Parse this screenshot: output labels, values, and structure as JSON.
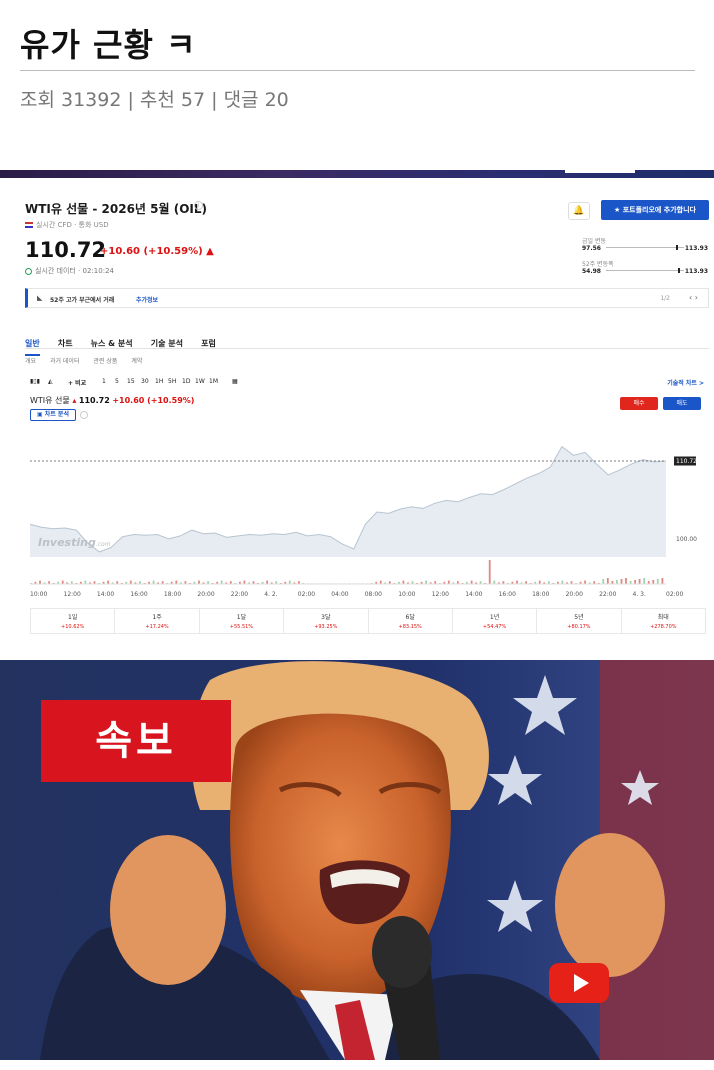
{
  "post": {
    "title": "유가 근황 ㅋ",
    "stats": "조회 31392 | 추천 57 | 댓글 20"
  },
  "screenshot": {
    "instrument_title": "WTI유 선물 - 2026년 5월 (OIL)",
    "subtitle": "실시간 CFD · 통화 USD",
    "price": "110.72",
    "change": "+10.60 (+10.59%) ▲",
    "time_label": "실시간 데이터 · 02:10:24",
    "portfolio_button": "포트폴리오에 추가합니다",
    "day_range": {
      "label": "금일 변동",
      "low": "97.56",
      "high": "113.93",
      "level": 0.92
    },
    "week52_range": {
      "label": "52주 변동폭",
      "low": "54.98",
      "high": "113.93",
      "level": 0.95
    },
    "alert": {
      "text": "52주 고가 부근에서 거래",
      "more": "추가정보",
      "page": "1/2",
      "arrows": "‹  ›"
    },
    "tabs": [
      "일반",
      "차트",
      "뉴스 & 분석",
      "기술 분석",
      "포럼"
    ],
    "subtabs": [
      "개요",
      "과거 데이터",
      "관련 상품",
      "계약"
    ],
    "toolbar": {
      "compare": "+ 비교",
      "intervals": [
        "1",
        "5",
        "15",
        "30",
        "1H",
        "5H",
        "1D",
        "1W",
        "1M"
      ],
      "technical_chart": "기술적 차트 >"
    },
    "mini": {
      "name": "WTI유 선물",
      "price": "110.72",
      "change": "+10.60 (+10.59%)",
      "chart_analysis": "차트 분석",
      "buy": "매수",
      "sell": "매도"
    },
    "watermark": "Investing",
    "watermark_suffix": ".com",
    "performance": [
      {
        "period": "1일",
        "value": "+10.62%"
      },
      {
        "period": "1주",
        "value": "+17.24%"
      },
      {
        "period": "1달",
        "value": "+55.51%"
      },
      {
        "period": "3달",
        "value": "+93.25%"
      },
      {
        "period": "6달",
        "value": "+83.15%"
      },
      {
        "period": "1년",
        "value": "+54.47%"
      },
      {
        "period": "5년",
        "value": "+80.17%"
      },
      {
        "period": "최대",
        "value": "+278.70%"
      }
    ]
  },
  "chart_data": {
    "type": "area",
    "title": "",
    "xlabel": "",
    "ylabel": "",
    "x": [
      "10:00",
      "12:00",
      "14:00",
      "16:00",
      "18:00",
      "20:00",
      "22:00",
      "4. 2.",
      "02:00",
      "04:00",
      "08:00",
      "10:00",
      "12:00",
      "14:00",
      "16:00",
      "18:00",
      "20:00",
      "22:00",
      "4. 3.",
      "02:00"
    ],
    "y_ticks": [
      "100.00",
      "110.72"
    ],
    "last_value": 110.72,
    "ylim": [
      97.5,
      113.2
    ],
    "values": [
      102.0,
      101.6,
      101.4,
      101.5,
      101.2,
      99.4,
      98.2,
      98.8,
      100.3,
      100.6,
      100.5,
      100.6,
      100.0,
      100.4,
      101.2,
      100.7,
      100.8,
      100.2,
      100.4,
      100.6,
      100.5,
      100.7,
      100.6,
      100.9,
      100.4,
      100.6,
      100.3,
      99.3,
      98.6,
      102.0,
      103.7,
      103.5,
      104.1,
      104.4,
      104.2,
      104.9,
      105.3,
      105.1,
      105.7,
      106.2,
      106.1,
      106.8,
      107.6,
      108.4,
      109.0,
      109.9,
      112.7,
      111.5,
      111.9,
      110.3,
      108.8,
      109.5,
      110.3,
      110.9,
      110.6,
      110.72
    ],
    "grid": false,
    "legend": "none"
  }
}
